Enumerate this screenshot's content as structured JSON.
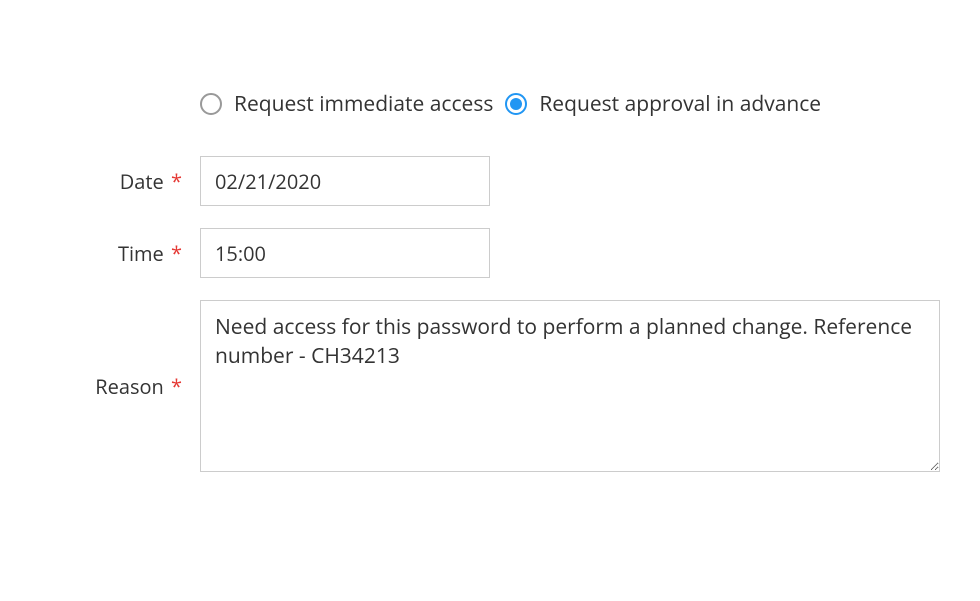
{
  "access_request": {
    "radio_options": {
      "immediate": {
        "label": "Request immediate access",
        "selected": false
      },
      "advance": {
        "label": "Request approval in advance",
        "selected": true
      }
    },
    "fields": {
      "date": {
        "label": "Date",
        "required_mark": "*",
        "value": "02/21/2020"
      },
      "time": {
        "label": "Time",
        "required_mark": "*",
        "value": "15:00"
      },
      "reason": {
        "label": "Reason",
        "required_mark": "*",
        "value": "Need access for this password to perform a planned change. Reference number - CH34213"
      }
    }
  }
}
